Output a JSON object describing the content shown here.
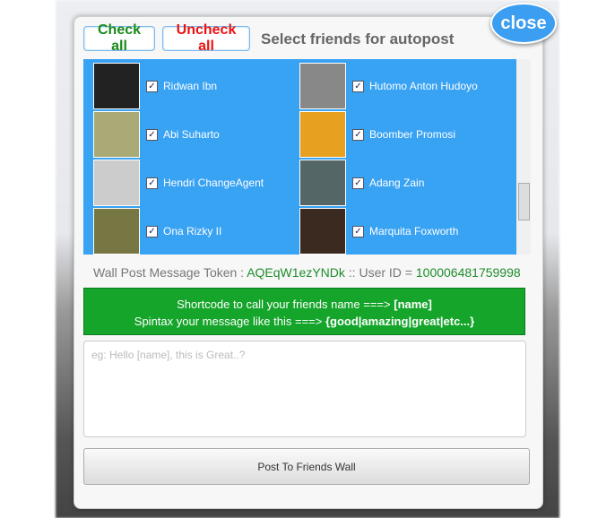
{
  "close_label": "close",
  "header": {
    "check_all": "Check all",
    "uncheck_all": "Uncheck all",
    "title": "Select friends for autopost"
  },
  "friends": [
    {
      "name": "Ridwan Ibn",
      "checked": true
    },
    {
      "name": "Hutomo Anton Hudoyo",
      "checked": true
    },
    {
      "name": "Abi Suharto",
      "checked": true
    },
    {
      "name": "Boomber Promosi",
      "checked": true
    },
    {
      "name": "Hendri ChangeAgent",
      "checked": true
    },
    {
      "name": "Adang Zain",
      "checked": true
    },
    {
      "name": "Ona Rizky II",
      "checked": true
    },
    {
      "name": "Marquita Foxworth",
      "checked": true
    }
  ],
  "token": {
    "label": "Wall Post Message Token :",
    "value": "AQEqW1ezYNDk",
    "sep": "::",
    "uid_label": "User ID =",
    "uid": "100006481759998"
  },
  "info": {
    "line1": "Shortcode to call your friends name ===>",
    "line1_bold": "[name]",
    "line2": "Spintax your message like this ===>",
    "line2_bold": "{good|amazing|great|etc...}"
  },
  "message": {
    "placeholder": "eg: Hello [name], this is Great..?",
    "value": ""
  },
  "post_button": "Post To Friends Wall",
  "colors": {
    "list_bg": "#38a2f3",
    "info_bg": "#15a52a",
    "check_all": "#1a8a1a",
    "uncheck_all": "#ee1111"
  }
}
